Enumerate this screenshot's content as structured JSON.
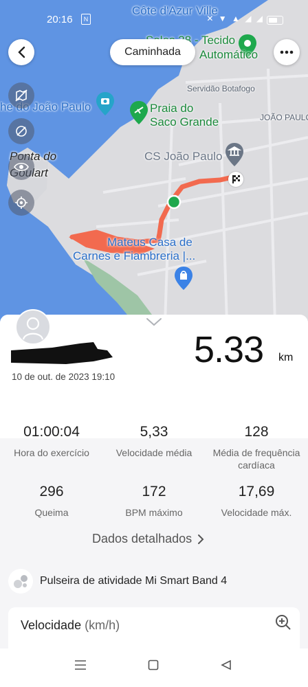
{
  "status_bar": {
    "time": "20:16",
    "nfc_label": "N",
    "icons_text": "✕ ▼ ▲ ◢ ◢"
  },
  "map": {
    "activity_pill": "Caminhada",
    "labels": {
      "cote": "Côte d'Azur Ville",
      "sales": "Sales 38 - Tecido",
      "sales2": "Automático",
      "servidao": "Servidão Botafogo",
      "joaopaulo_right": "JOÃO PAULO",
      "joaopaulo_left": "he do João Paulo",
      "praia1": "Praia do",
      "praia2": "Saco Grande",
      "cs": "CS João Paulo",
      "ponta1": "Ponta do",
      "ponta2": "Goulart",
      "mateus1": "Mateus Casa de",
      "mateus2": "Carnes e Fiambreria |..."
    }
  },
  "summary": {
    "date": "10 de out. de 2023 19:10",
    "distance": "5.33",
    "distance_unit": "km"
  },
  "stats": [
    {
      "value": "01:00:04",
      "label": "Hora do exercício"
    },
    {
      "value": "5,33",
      "label": "Velocidade média"
    },
    {
      "value": "128",
      "label": "Média de frequência cardíaca"
    },
    {
      "value": "296",
      "label": "Queima"
    },
    {
      "value": "172",
      "label": "BPM máximo"
    },
    {
      "value": "17,69",
      "label": "Velocidade máx."
    }
  ],
  "detail_link": "Dados detalhados",
  "device": {
    "label": "Pulseira de atividade Mi Smart Band 4"
  },
  "speed_card": {
    "title": "Velocidade",
    "unit": "(km/h)"
  },
  "colors": {
    "route": "#f26a4f",
    "sea": "#5f94e3",
    "land": "#dcdcdf",
    "start": "#1ea84d"
  }
}
